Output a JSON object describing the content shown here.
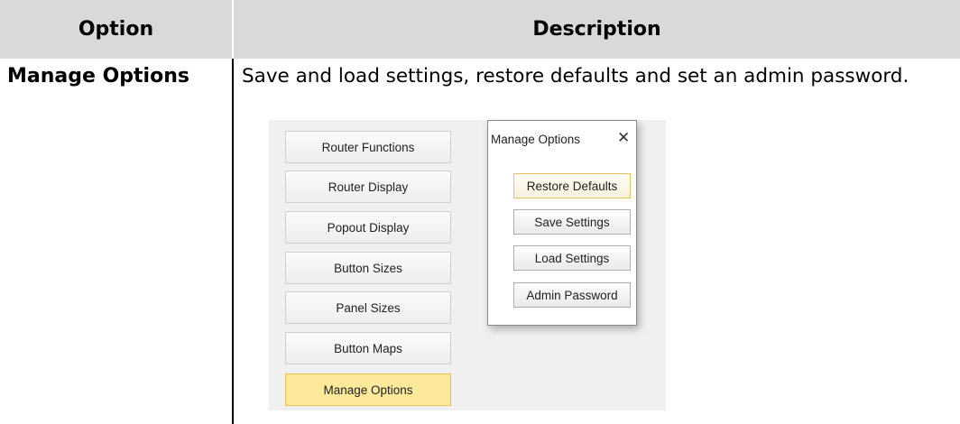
{
  "table": {
    "headers": {
      "option": "Option",
      "description": "Description"
    },
    "row": {
      "option": "Manage Options",
      "description": "Save and load settings, restore defaults and set an admin password."
    }
  },
  "screenshot": {
    "menu_items": [
      {
        "label": "Router Functions",
        "active": false
      },
      {
        "label": "Router Display",
        "active": false
      },
      {
        "label": "Popout Display",
        "active": false
      },
      {
        "label": "Button Sizes",
        "active": false
      },
      {
        "label": "Panel Sizes",
        "active": false
      },
      {
        "label": "Button Maps",
        "active": false
      },
      {
        "label": "Manage Options",
        "active": true
      }
    ],
    "dialog": {
      "title": "Manage Options",
      "close_icon": "close-icon",
      "buttons": [
        {
          "label": "Restore Defaults"
        },
        {
          "label": "Save Settings"
        },
        {
          "label": "Load Settings"
        },
        {
          "label": "Admin Password"
        }
      ]
    }
  },
  "colors": {
    "header_bg": "#d9d9d9",
    "active_menu_bg": "#fde99a",
    "focus_border": "#e8c35c"
  }
}
